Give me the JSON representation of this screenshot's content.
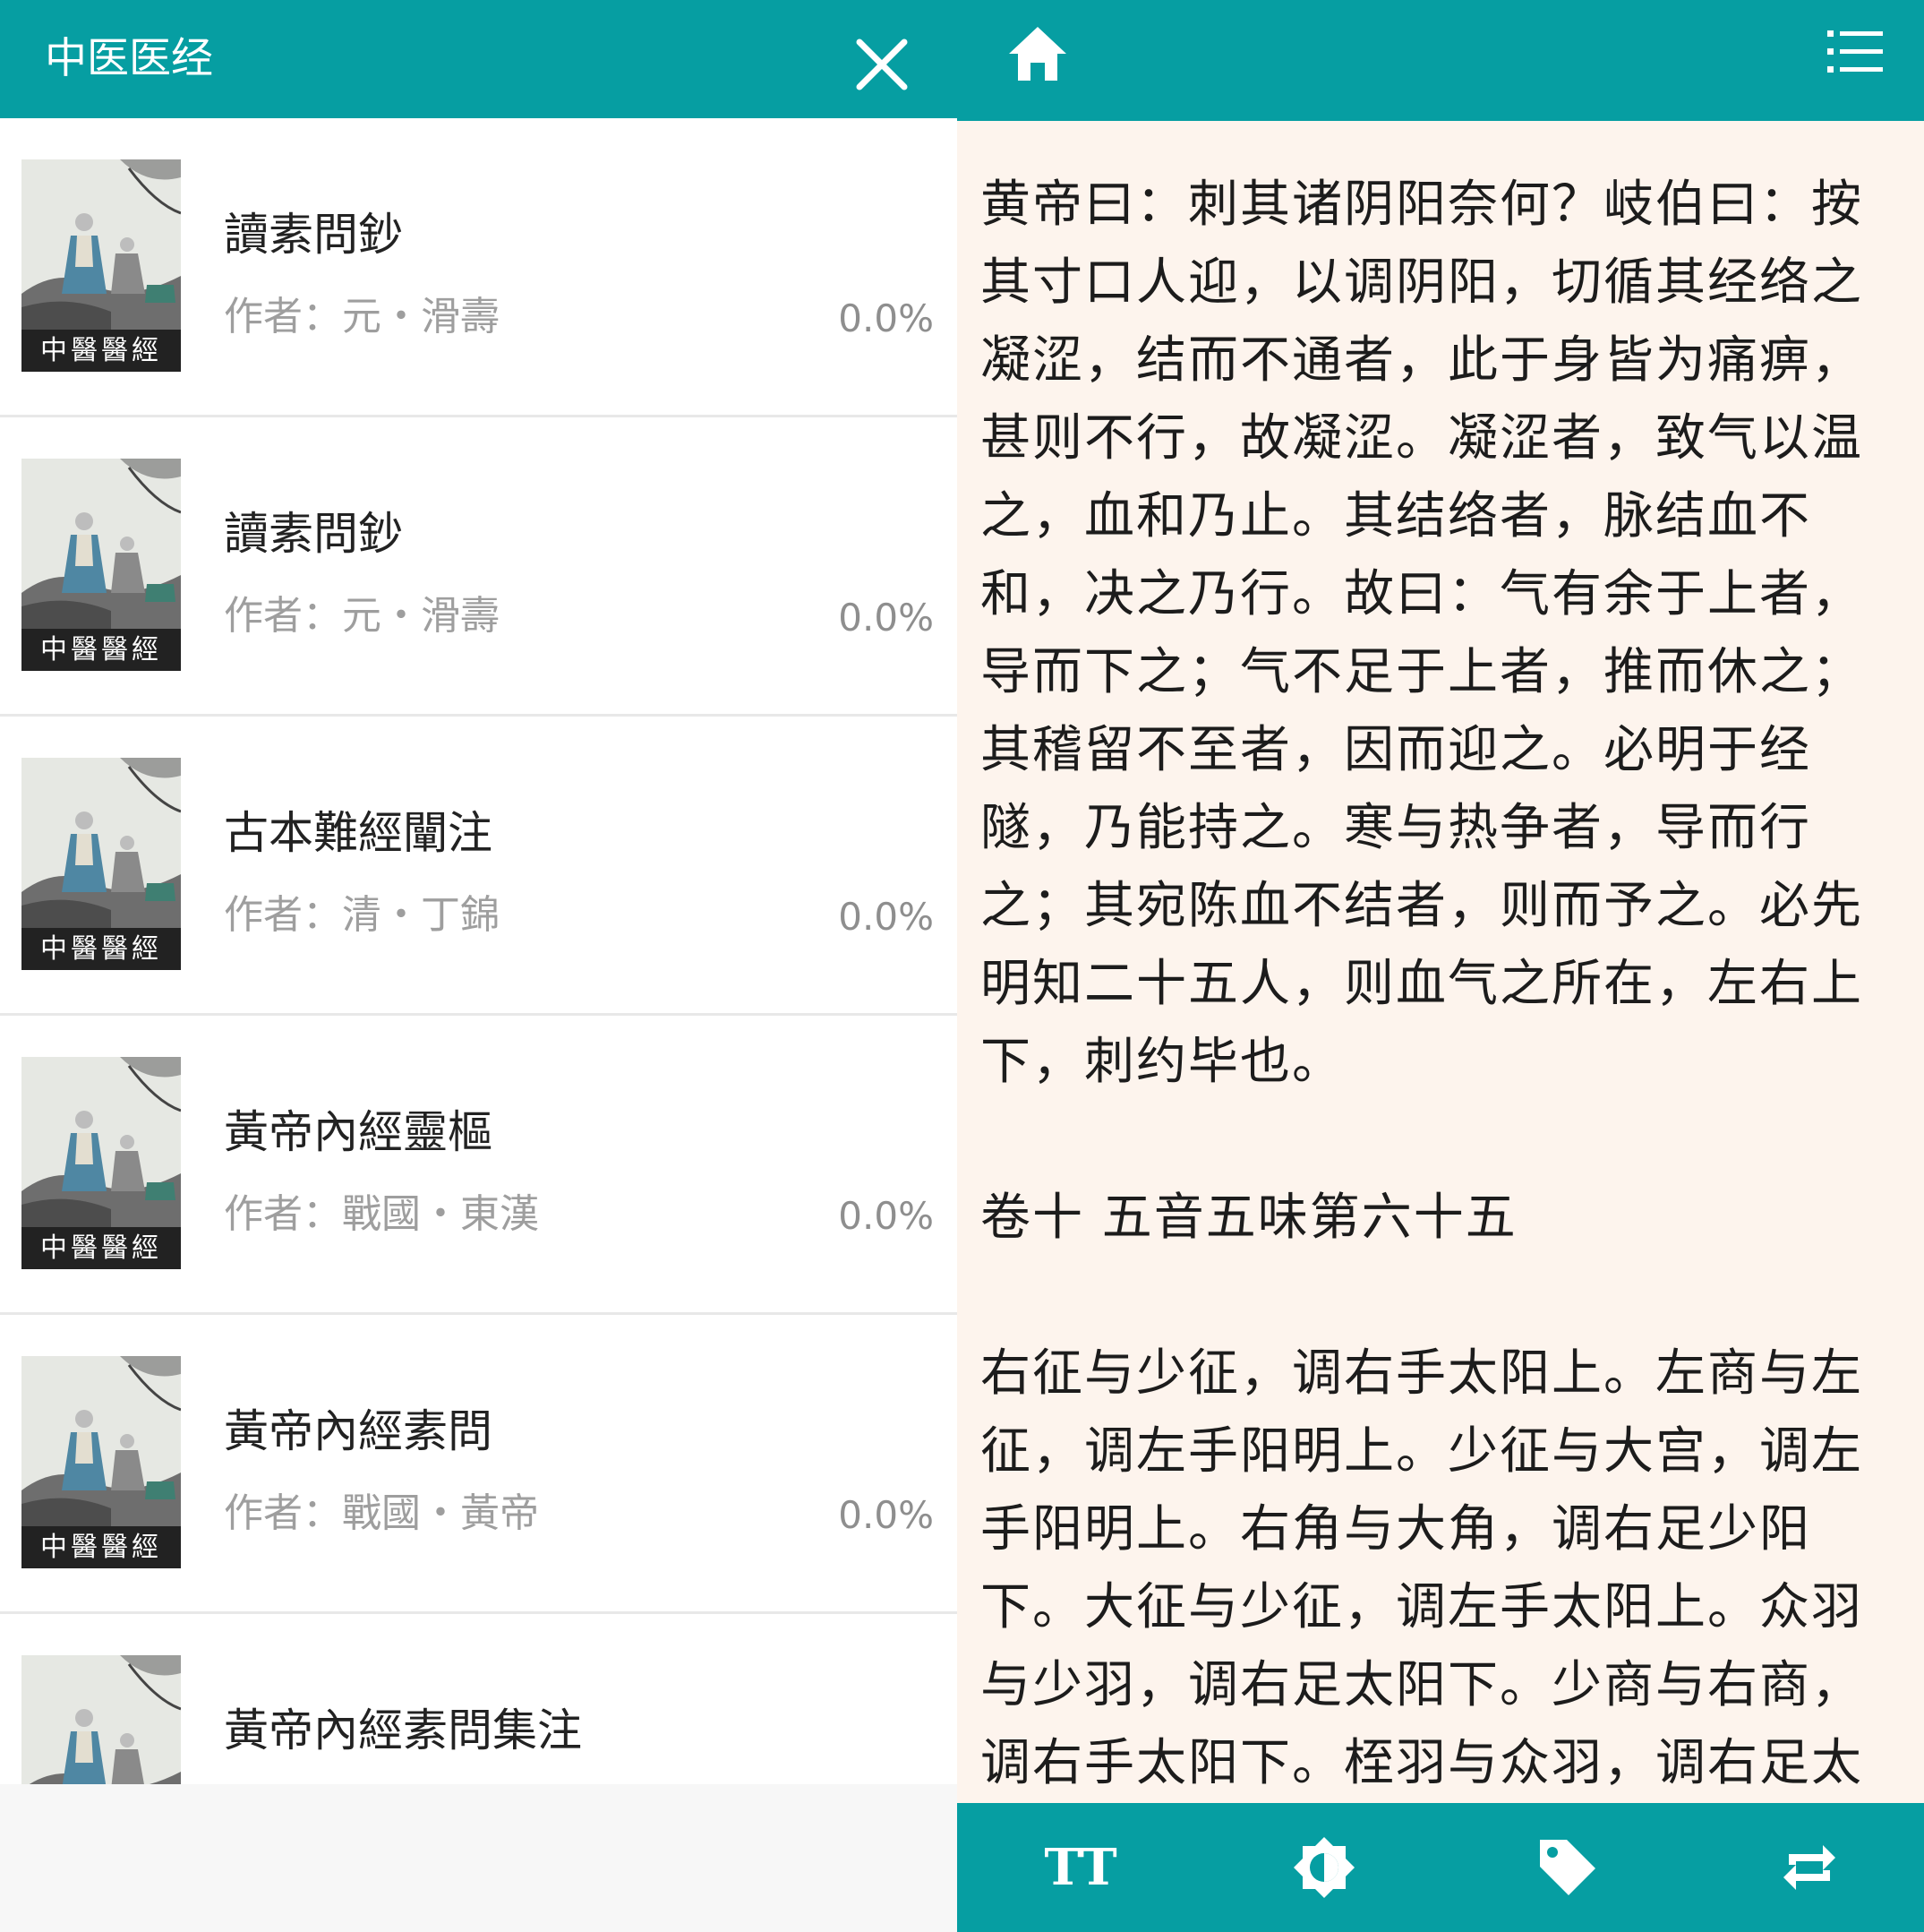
{
  "left_panel": {
    "title": "中医医经",
    "close_icon": "close-icon",
    "books": [
      {
        "title": "讀素問鈔",
        "author": "作者：元・滑壽",
        "progress": "0.0%",
        "cover_label": "中醫醫經"
      },
      {
        "title": "讀素問鈔",
        "author": "作者：元・滑壽",
        "progress": "0.0%",
        "cover_label": "中醫醫經"
      },
      {
        "title": "古本難經闡注",
        "author": "作者：清・丁錦",
        "progress": "0.0%",
        "cover_label": "中醫醫經"
      },
      {
        "title": "黃帝內經靈樞",
        "author": "作者：戰國・東漢",
        "progress": "0.0%",
        "cover_label": "中醫醫經"
      },
      {
        "title": "黃帝內經素問",
        "author": "作者：戰國・黃帝",
        "progress": "0.0%",
        "cover_label": "中醫醫經"
      },
      {
        "title": "黃帝內經素問集注",
        "author": "",
        "progress": "",
        "cover_label": ""
      }
    ]
  },
  "reader": {
    "toolbar": {
      "home_icon": "home-icon",
      "menu_icon": "list-menu-icon"
    },
    "paragraph_1": "黄帝曰：刺其诸阴阳奈何？岐伯曰：按其寸口人迎，以调阴阳，切循其经络之凝涩，结而不通者，此于身皆为痛痹，甚则不行，故凝涩。凝涩者，致气以温之，血和乃止。其结络者，脉结血不和，决之乃行。故曰：气有余于上者，导而下之；气不足于上者，推而休之；其稽留不至者，因而迎之。必明于经隧，乃能持之。寒与热争者，导而行之；其宛陈血不结者，则而予之。必先明知二十五人，则血气之所在，左右上下，刺约毕也。",
    "chapter_title": "卷十 五音五味第六十五",
    "paragraph_2": "右征与少征，调右手太阳上。左商与左征，调左手阳明上。少征与大宫，调左手阳明上。右角与大角，调右足少阳下。大征与少征，调左手太阳上。众羽与少羽，调右足太阳下。少商与右商，调右手太阳下。桎羽与众羽，调右足太阳"
  },
  "bottom_bar": {
    "font_size_label": "TT",
    "icons": [
      "font-size-icon",
      "brightness-icon",
      "tag-icon",
      "swap-icon"
    ]
  },
  "colors": {
    "accent": "#069ea2",
    "reader_bg": "#fdf4ed",
    "text": "#1c1c1c",
    "muted": "#9e9e9e"
  }
}
